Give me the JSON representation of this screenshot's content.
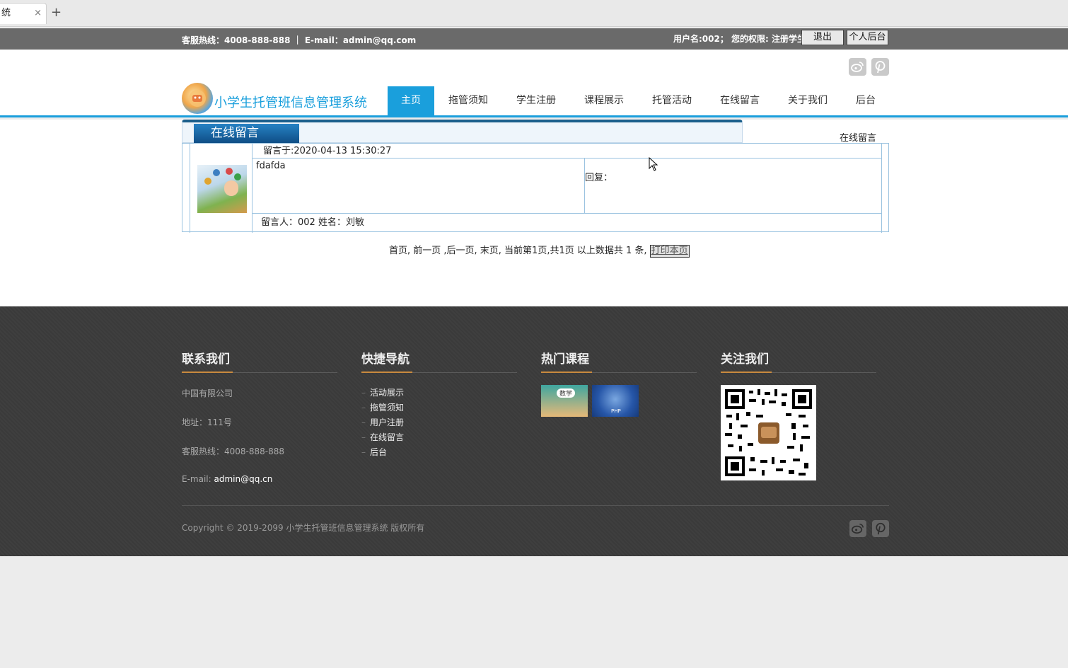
{
  "browser": {
    "tab_title": "统",
    "tab_close": "×",
    "new_tab": "+"
  },
  "topbar": {
    "hotline": "客服热线：4008-888-888  ｜ E-mail：admin@qq.com",
    "userinfo": "用户名:002；  您的权限: 注册学生",
    "logout_label": "退出",
    "backend_label": "个人后台"
  },
  "header": {
    "site_name": "小学生托管班信息管理系统",
    "nav": [
      "主页",
      "拖管须知",
      "学生注册",
      "课程展示",
      "托管活动",
      "在线留言",
      "关于我们",
      "后台"
    ],
    "active_nav": "主页",
    "accent_color": "#1a9fdc"
  },
  "content": {
    "panel_title": "在线留言",
    "breadcrumb": "在线留言",
    "message": {
      "date": "留言于:2020-04-13 15:30:27",
      "body": "fdafda",
      "reply_label": "回复：",
      "author": "留言人：002     姓名：刘敏"
    },
    "pager_text": "首页, 前一页 ,后一页, 末页, 当前第1页,共1页 以上数据共 1 条, ",
    "print_label": "打印本页"
  },
  "footer": {
    "contact": {
      "title": "联系我们",
      "company": "中国有限公司",
      "address": "地址：111号",
      "hotline": "客服热线：4008-888-888",
      "email_label": "E-mail: ",
      "email": "admin@qq.cn"
    },
    "quick_nav": {
      "title": "快捷导航",
      "links": [
        "活动展示",
        "拖管须知",
        "用户注册",
        "在线留言",
        "后台"
      ]
    },
    "hot_courses": {
      "title": "热门课程",
      "course1_text": "数学",
      "course2_text": "PHP"
    },
    "follow": {
      "title": "关注我们"
    },
    "copyright": "Copyright © 2019-2099 小学生托管班信息管理系统 版权所有"
  }
}
